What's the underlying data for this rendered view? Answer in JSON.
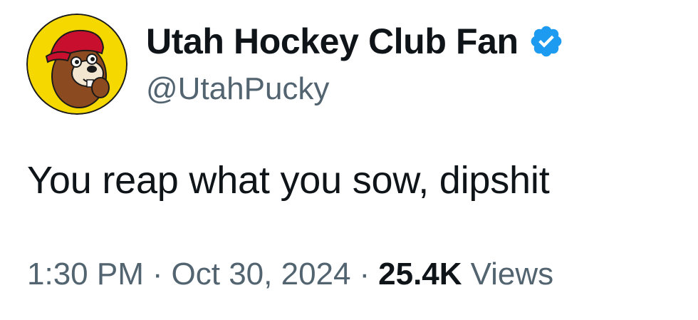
{
  "author": {
    "display_name": "Utah Hockey Club Fan",
    "handle": "@UtahPucky",
    "avatar_icon": "beaver-mascot-avatar",
    "verified_icon": "verified-badge-icon",
    "verified_color": "#1d9bf0"
  },
  "tweet": {
    "text": "You reap what you sow, dipshit"
  },
  "meta": {
    "time": "1:30 PM",
    "separator": "·",
    "date": "Oct 30, 2024",
    "views_count": "25.4K",
    "views_label": "Views"
  },
  "colors": {
    "text_primary": "#0f1419",
    "text_secondary": "#536471",
    "avatar_bg": "#f5d800"
  }
}
